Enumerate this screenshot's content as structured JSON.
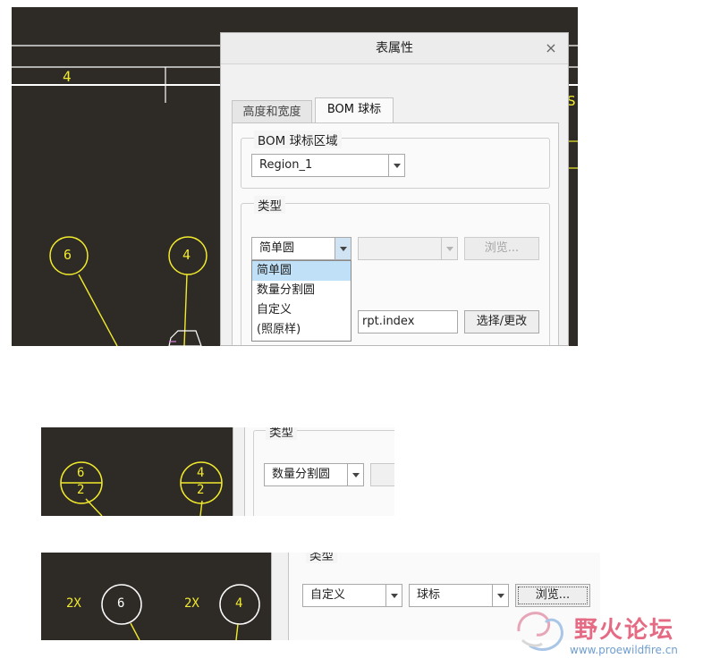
{
  "dialog": {
    "title": "表属性",
    "close_glyph": "×",
    "tabs": [
      {
        "label": "高度和宽度",
        "active": false
      },
      {
        "label": "BOM 球标",
        "active": true
      }
    ],
    "region_group": {
      "title": "BOM 球标区域",
      "selected": "Region_1"
    },
    "type_group": {
      "title": "类型",
      "type_selected": "简单圆",
      "browse_label": "浏览...",
      "dropdown_options": [
        "简单圆",
        "数量分割圆",
        "自定义",
        "(照原样)"
      ],
      "dropdown_selected_index": 0,
      "param_value": "rpt.index",
      "select_change_label": "选择/更改"
    }
  },
  "cad_top": {
    "labels": {
      "cell_number": "4",
      "right_edge_char": "S"
    },
    "balloons": [
      {
        "text": "6"
      },
      {
        "text": "4"
      }
    ]
  },
  "panel2": {
    "type_group_title": "类型",
    "type_selected": "数量分割圆",
    "balloons": [
      {
        "top": "6",
        "bottom": "2"
      },
      {
        "top": "4",
        "bottom": "2"
      }
    ]
  },
  "panel3": {
    "type_group_title": "类型",
    "type_selected": "自定义",
    "symbol_selected": "球标",
    "browse_label": "浏览...",
    "balloons": [
      {
        "prefix": "2X",
        "text": "6"
      },
      {
        "prefix": "2X",
        "text": "4"
      }
    ]
  },
  "watermark": {
    "text": "野火论坛",
    "url": "www.proewildfire.cn"
  },
  "colors": {
    "cad_background": "#2e2b27",
    "cad_yellow": "#f1ea2c",
    "cad_white": "#ffffff",
    "selection_blue": "#bfe0f7"
  }
}
